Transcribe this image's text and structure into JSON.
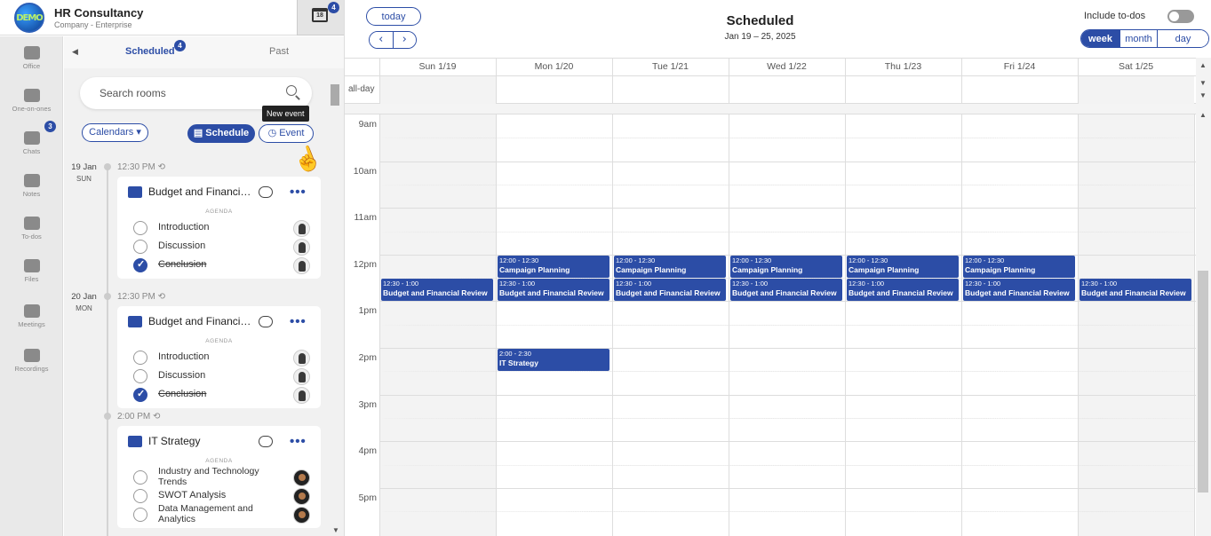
{
  "org": {
    "logo_text": "DEMO",
    "name": "HR Consultancy",
    "subtitle": "Company - Enterprise",
    "calendar_icon_day": "18",
    "calendar_badge": "4"
  },
  "rail": [
    {
      "label": "Office",
      "icon": "briefcase-icon"
    },
    {
      "label": "One-on-ones",
      "icon": "people-icon"
    },
    {
      "label": "Chats",
      "icon": "chat-icon",
      "badge": "3"
    },
    {
      "label": "Notes",
      "icon": "notes-icon"
    },
    {
      "label": "To-dos",
      "icon": "checkbox-icon"
    },
    {
      "label": "Files",
      "icon": "files-icon"
    },
    {
      "label": "Meetings",
      "icon": "meetings-icon"
    },
    {
      "label": "Recordings",
      "icon": "recordings-icon"
    }
  ],
  "panel": {
    "tab_scheduled": "Scheduled",
    "tab_scheduled_badge": "4",
    "tab_past": "Past",
    "search_placeholder": "Search rooms",
    "calendars_label": "Calendars ▾",
    "schedule_label": "Schedule",
    "event_label": "Event",
    "tooltip": "New event",
    "days": [
      {
        "date": "19 Jan",
        "dow": "SUN",
        "events": [
          {
            "time": "12:30 PM",
            "title": "Budget and Financial Review",
            "agenda_label": "AGENDA",
            "items": [
              {
                "text": "Introduction",
                "done": false
              },
              {
                "text": "Discussion",
                "done": false
              },
              {
                "text": "Conclusion",
                "done": true
              }
            ]
          }
        ]
      },
      {
        "date": "20 Jan",
        "dow": "MON",
        "events": [
          {
            "time": "12:30 PM",
            "title": "Budget and Financial Review",
            "agenda_label": "AGENDA",
            "items": [
              {
                "text": "Introduction",
                "done": false
              },
              {
                "text": "Discussion",
                "done": false
              },
              {
                "text": "Conclusion",
                "done": true
              }
            ]
          },
          {
            "time": "2:00 PM",
            "title": "IT Strategy",
            "agenda_label": "AGENDA",
            "items": [
              {
                "text": "Industry and Technology Trends",
                "done": false
              },
              {
                "text": "SWOT Analysis",
                "done": false
              },
              {
                "text": "Data Management and Analytics",
                "done": false
              }
            ]
          }
        ]
      }
    ]
  },
  "calendar": {
    "today_label": "today",
    "prev_label": "‹",
    "next_label": "›",
    "title": "Scheduled",
    "range": "Jan 19 – 25, 2025",
    "include_todos_label": "Include to-dos",
    "include_todos_on": false,
    "views": [
      "week",
      "month",
      "day"
    ],
    "active_view": "week",
    "allday_label": "all-day",
    "days": [
      "Sun 1/19",
      "Mon 1/20",
      "Tue 1/21",
      "Wed 1/22",
      "Thu 1/23",
      "Fri 1/24",
      "Sat 1/25"
    ],
    "hours": [
      "9am",
      "10am",
      "11am",
      "12pm",
      "1pm",
      "2pm",
      "3pm",
      "4pm",
      "5pm"
    ],
    "events": [
      {
        "day": 1,
        "start": 12.0,
        "end": 12.5,
        "time": "12:00 - 12:30",
        "title": "Campaign Planning"
      },
      {
        "day": 2,
        "start": 12.0,
        "end": 12.5,
        "time": "12:00 - 12:30",
        "title": "Campaign Planning"
      },
      {
        "day": 3,
        "start": 12.0,
        "end": 12.5,
        "time": "12:00 - 12:30",
        "title": "Campaign Planning"
      },
      {
        "day": 4,
        "start": 12.0,
        "end": 12.5,
        "time": "12:00 - 12:30",
        "title": "Campaign Planning"
      },
      {
        "day": 5,
        "start": 12.0,
        "end": 12.5,
        "time": "12:00 - 12:30",
        "title": "Campaign Planning"
      },
      {
        "day": 0,
        "start": 12.5,
        "end": 13.0,
        "time": "12:30 - 1:00",
        "title": "Budget and Financial Review"
      },
      {
        "day": 1,
        "start": 12.5,
        "end": 13.0,
        "time": "12:30 - 1:00",
        "title": "Budget and Financial Review"
      },
      {
        "day": 2,
        "start": 12.5,
        "end": 13.0,
        "time": "12:30 - 1:00",
        "title": "Budget and Financial Review"
      },
      {
        "day": 3,
        "start": 12.5,
        "end": 13.0,
        "time": "12:30 - 1:00",
        "title": "Budget and Financial Review"
      },
      {
        "day": 4,
        "start": 12.5,
        "end": 13.0,
        "time": "12:30 - 1:00",
        "title": "Budget and Financial Review"
      },
      {
        "day": 5,
        "start": 12.5,
        "end": 13.0,
        "time": "12:30 - 1:00",
        "title": "Budget and Financial Review"
      },
      {
        "day": 6,
        "start": 12.5,
        "end": 13.0,
        "time": "12:30 - 1:00",
        "title": "Budget and Financial Review"
      },
      {
        "day": 1,
        "start": 14.0,
        "end": 14.5,
        "time": "2:00 - 2:30",
        "title": "IT Strategy"
      }
    ]
  }
}
